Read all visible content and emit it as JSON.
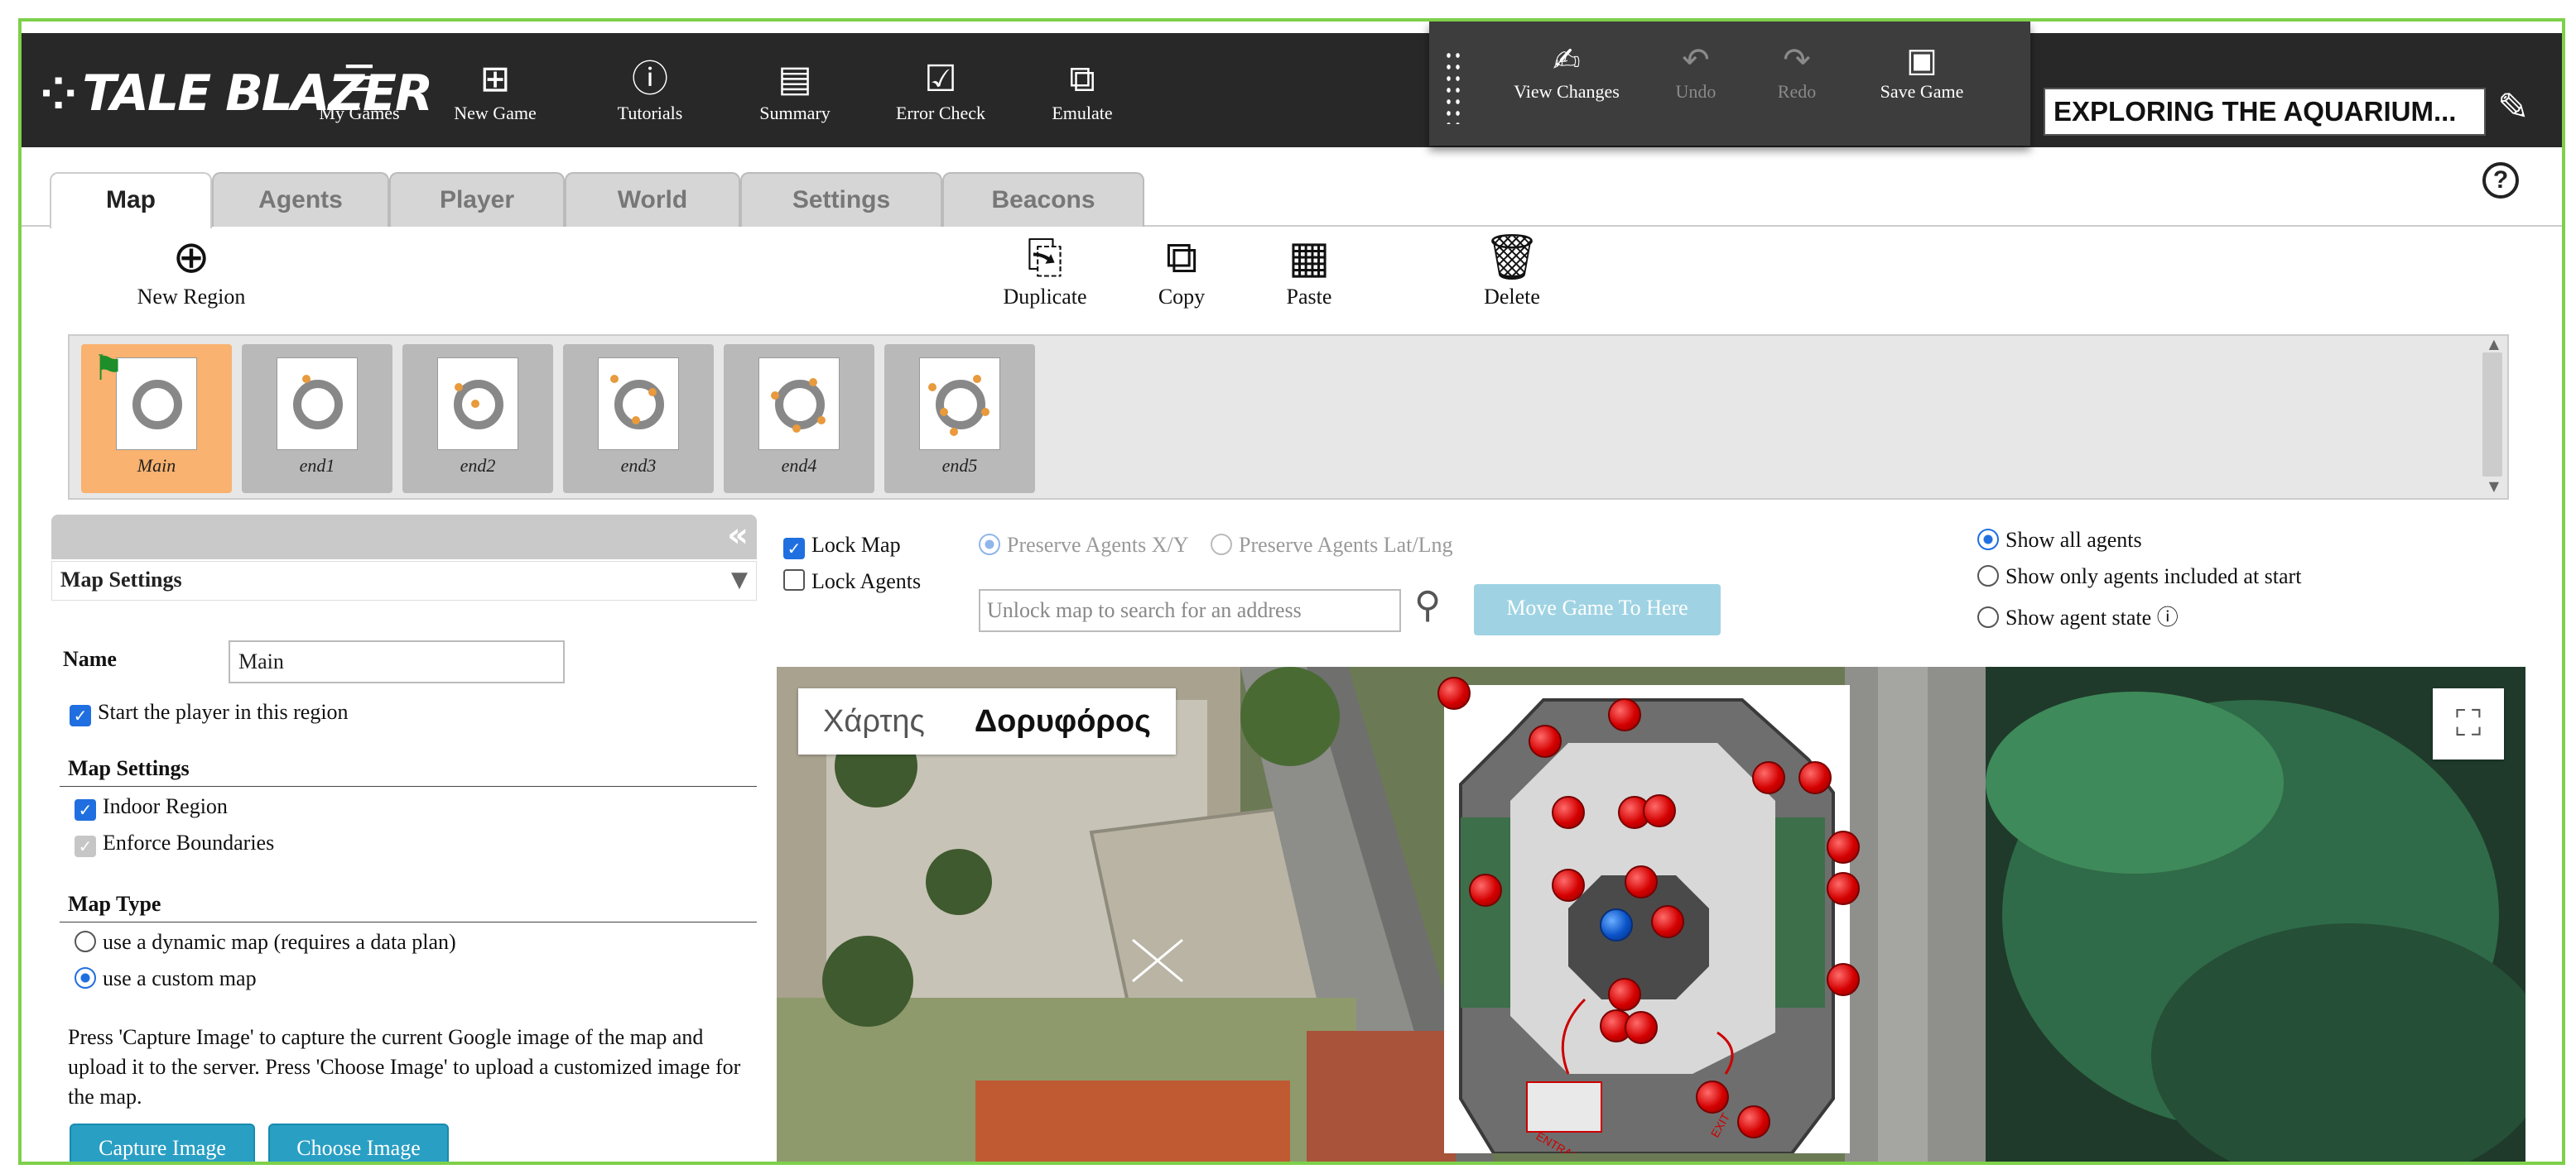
{
  "app": {
    "logo": "TALE BLAZER",
    "game_title": "EXPLORING THE AQUARIUM..."
  },
  "nav": [
    {
      "label": "My Games",
      "icon": "list-icon"
    },
    {
      "label": "New Game",
      "icon": "new-game-icon"
    },
    {
      "label": "Tutorials",
      "icon": "help-circle-icon"
    },
    {
      "label": "Summary",
      "icon": "summary-icon"
    },
    {
      "label": "Error Check",
      "icon": "checkbox-icon"
    },
    {
      "label": "Emulate",
      "icon": "emulate-icon"
    }
  ],
  "changes": [
    {
      "label": "View Changes",
      "icon": "changes-icon",
      "enabled": true
    },
    {
      "label": "Undo",
      "icon": "undo-icon",
      "enabled": false
    },
    {
      "label": "Redo",
      "icon": "redo-icon",
      "enabled": false
    },
    {
      "label": "Save Game",
      "icon": "save-icon",
      "enabled": true
    }
  ],
  "tabs": [
    "Map",
    "Agents",
    "Player",
    "World",
    "Settings",
    "Beacons"
  ],
  "active_tab": "Map",
  "toolbar": {
    "new_region": "New Region",
    "duplicate": "Duplicate",
    "copy": "Copy",
    "paste": "Paste",
    "delete": "Delete"
  },
  "regions": [
    {
      "label": "Main",
      "active": true,
      "start": true
    },
    {
      "label": "end1",
      "active": false
    },
    {
      "label": "end2",
      "active": false
    },
    {
      "label": "end3",
      "active": false
    },
    {
      "label": "end4",
      "active": false
    },
    {
      "label": "end5",
      "active": false
    }
  ],
  "map_settings": {
    "panel_title": "Map Settings",
    "name_label": "Name",
    "name_value": "Main",
    "start_player": "Start the player in this region",
    "section_map_settings": "Map Settings",
    "indoor_region": "Indoor Region",
    "enforce_boundaries": "Enforce Boundaries",
    "section_map_type": "Map Type",
    "dynamic_map": "use a dynamic map (requires a data plan)",
    "custom_map": "use a custom map",
    "help_text": "Press 'Capture Image' to capture the current Google image of the map and upload it to the server. Press 'Choose Image' to upload a customized image for the map.",
    "capture_image": "Capture Image",
    "choose_image": "Choose Image"
  },
  "map_controls": {
    "lock_map": "Lock Map",
    "lock_agents": "Lock Agents",
    "preserve_xy": "Preserve Agents X/Y",
    "preserve_latlng": "Preserve Agents Lat/Lng",
    "search_placeholder": "Unlock map to search for an address",
    "move_game": "Move Game To Here",
    "show_all": "Show all agents",
    "show_included": "Show only agents included at start",
    "show_state": "Show agent state"
  },
  "map_view": {
    "map_label": "Χάρτης",
    "satellite_label": "Δορυφόρος",
    "selected": "satellite"
  },
  "colors": {
    "accent": "#2a9fc4",
    "header": "#282828",
    "active_region": "#f9b26f",
    "frame": "#7ed04b",
    "pin": "#d40000",
    "player_pin": "#0a52c8"
  }
}
